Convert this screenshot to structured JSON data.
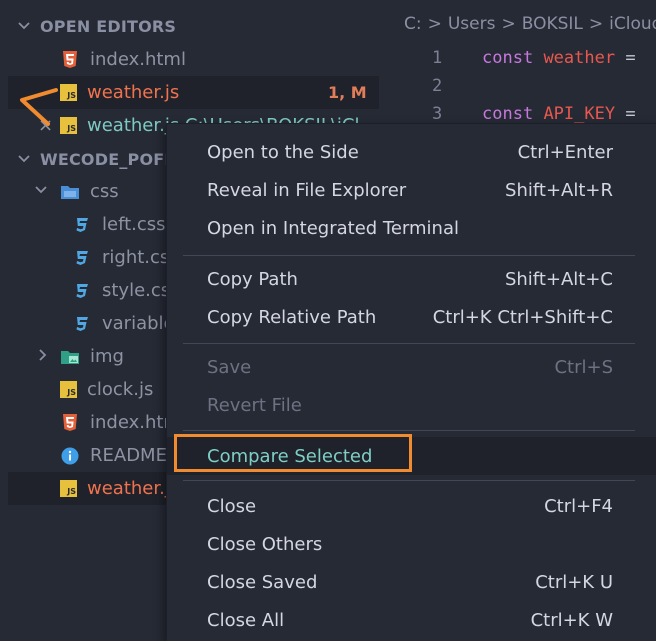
{
  "explorer": {
    "open_editors_title": "OPEN EDITORS",
    "open_editors": [
      {
        "label": "index.html",
        "icon": "html5-icon"
      },
      {
        "label": "weather.js",
        "icon": "js-icon",
        "badge": "1, M"
      },
      {
        "label": "weather.js  C:\\Users\\BOKSIL\\iCl",
        "icon": "js-icon",
        "close": "×"
      }
    ],
    "workspace_title": "WECODE_POFILE",
    "tree": [
      {
        "label": "css",
        "icon": "folder-icon"
      },
      {
        "label": "left.css",
        "icon": "css3-icon"
      },
      {
        "label": "right.css",
        "icon": "css3-icon"
      },
      {
        "label": "style.css",
        "icon": "css3-icon"
      },
      {
        "label": "variables.css",
        "icon": "css3-icon"
      },
      {
        "label": "img",
        "icon": "image-folder-icon"
      },
      {
        "label": "clock.js",
        "icon": "js-icon"
      },
      {
        "label": "index.html",
        "icon": "html5-icon"
      },
      {
        "label": "README.md",
        "icon": "info-icon"
      },
      {
        "label": "weather.js",
        "icon": "js-icon"
      }
    ],
    "js_badge": "JS"
  },
  "editor": {
    "breadcrumb": [
      "C:",
      ">",
      "Users",
      ">",
      "BOKSIL",
      ">",
      "iCloud"
    ],
    "lines": [
      {
        "num": "1",
        "kw": "const",
        "name": "weather",
        "op": "="
      },
      {
        "num": "2",
        "kw": "",
        "name": "",
        "op": ""
      },
      {
        "num": "3",
        "kw": "const",
        "name": "API_KEY",
        "op": "="
      }
    ]
  },
  "menu": {
    "items": [
      {
        "label": "Open to the Side",
        "key": "Ctrl+Enter"
      },
      {
        "label": "Reveal in File Explorer",
        "key": "Shift+Alt+R"
      },
      {
        "label": "Open in Integrated Terminal",
        "key": ""
      },
      {
        "label": "Copy Path",
        "key": "Shift+Alt+C"
      },
      {
        "label": "Copy Relative Path",
        "key": "Ctrl+K Ctrl+Shift+C"
      },
      {
        "label": "Save",
        "key": "Ctrl+S"
      },
      {
        "label": "Revert File",
        "key": ""
      },
      {
        "label": "Compare Selected",
        "key": ""
      },
      {
        "label": "Close",
        "key": "Ctrl+F4"
      },
      {
        "label": "Close Others",
        "key": ""
      },
      {
        "label": "Close Saved",
        "key": "Ctrl+K U"
      },
      {
        "label": "Close All",
        "key": "Ctrl+K W"
      }
    ]
  },
  "colors": {
    "accent_highlight": "#f08b2f",
    "modified_red": "#f0734e",
    "active_teal": "#7fc9c3"
  }
}
